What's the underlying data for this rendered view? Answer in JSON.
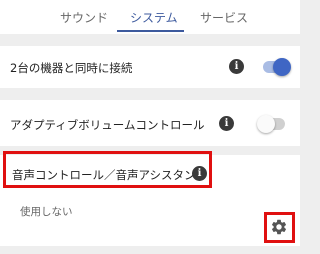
{
  "tabs": [
    {
      "label": "サウンド",
      "active": false
    },
    {
      "label": "システム",
      "active": true
    },
    {
      "label": "サービス",
      "active": false
    }
  ],
  "settings": [
    {
      "label": "2台の機器と同時に接続",
      "toggle": "on"
    },
    {
      "label": "アダプティブボリュームコントロール",
      "toggle": "off"
    }
  ],
  "voice": {
    "label": "音声コントロール／音声アシスタント",
    "value": "使用しない"
  },
  "icons": {
    "info": "info-icon",
    "settings": "gear-icon"
  },
  "colors": {
    "accent": "#3d5a9e",
    "highlight": "#e01010",
    "toggle_on": "#3f66c4"
  }
}
